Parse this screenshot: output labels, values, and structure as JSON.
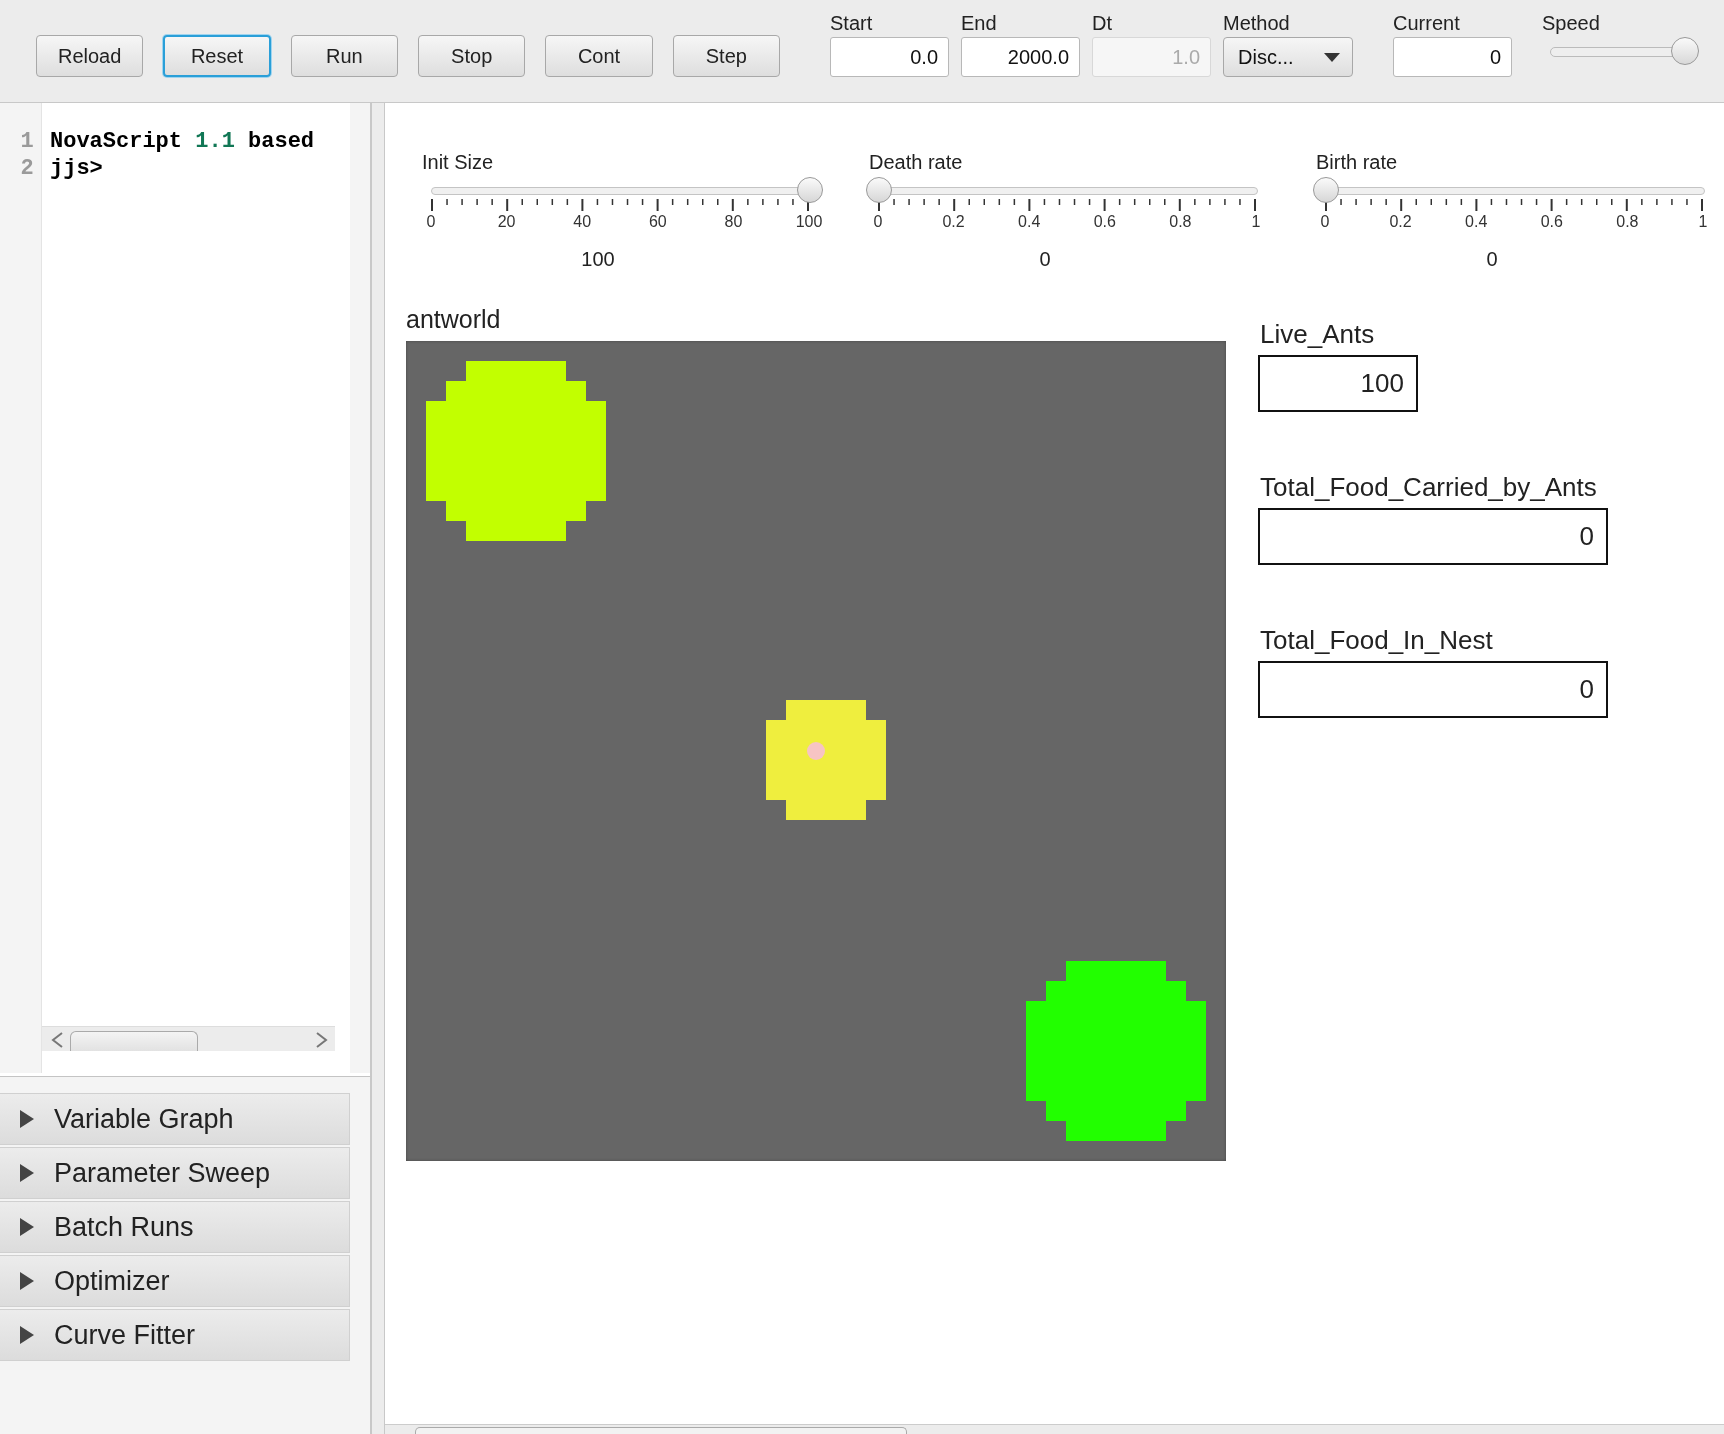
{
  "toolbar": {
    "buttons": [
      {
        "label": "Reload",
        "focused": false
      },
      {
        "label": "Reset",
        "focused": true
      },
      {
        "label": "Run",
        "focused": false
      },
      {
        "label": "Stop",
        "focused": false
      },
      {
        "label": "Cont",
        "focused": false
      },
      {
        "label": "Step",
        "focused": false
      }
    ],
    "fields": [
      {
        "kind": "input",
        "label": "Start",
        "value": "0.0",
        "disabled": false
      },
      {
        "kind": "input",
        "label": "End",
        "value": "2000.0",
        "disabled": false
      },
      {
        "kind": "input",
        "label": "Dt",
        "value": "1.0",
        "disabled": true
      },
      {
        "kind": "dropdown",
        "label": "Method",
        "value": "Disc..."
      },
      {
        "kind": "input",
        "label": "Current",
        "value": "0",
        "disabled": false
      },
      {
        "kind": "slider",
        "label": "Speed",
        "level": 1
      }
    ]
  },
  "console": {
    "lines": [
      {
        "number": "1",
        "tokens": [
          {
            "kind": "text",
            "text": "NovaScript "
          },
          {
            "kind": "number",
            "text": "1.1"
          },
          {
            "kind": "text",
            "text": " based"
          }
        ]
      },
      {
        "number": "2",
        "tokens": [
          {
            "kind": "text",
            "text": "jjs>"
          }
        ]
      }
    ]
  },
  "panels": [
    {
      "title": "Variable Graph",
      "expanded": false
    },
    {
      "title": "Parameter Sweep",
      "expanded": false
    },
    {
      "title": "Batch Runs",
      "expanded": false
    },
    {
      "title": "Optimizer",
      "expanded": false
    },
    {
      "title": "Curve Fitter",
      "expanded": false
    }
  ],
  "parameters": [
    {
      "label": "Init Size",
      "level": 1,
      "ticks": [
        "0",
        "20",
        "40",
        "60",
        "80",
        "100"
      ],
      "value": "100"
    },
    {
      "label": "Death rate",
      "level": 0,
      "ticks": [
        "0",
        "0.2",
        "0.4",
        "0.6",
        "0.8",
        "1"
      ],
      "value": "0"
    },
    {
      "label": "Birth rate",
      "level": 0,
      "ticks": [
        "0",
        "0.2",
        "0.4",
        "0.6",
        "0.8",
        "1"
      ],
      "value": "0"
    }
  ],
  "world": {
    "title": "antworld"
  },
  "outputs": [
    {
      "label": "Live_Ants",
      "value": "100"
    },
    {
      "label": "Total_Food_Carried_by_Ants",
      "value": "0"
    },
    {
      "label": "Total_Food_In_Nest",
      "value": "0"
    }
  ]
}
